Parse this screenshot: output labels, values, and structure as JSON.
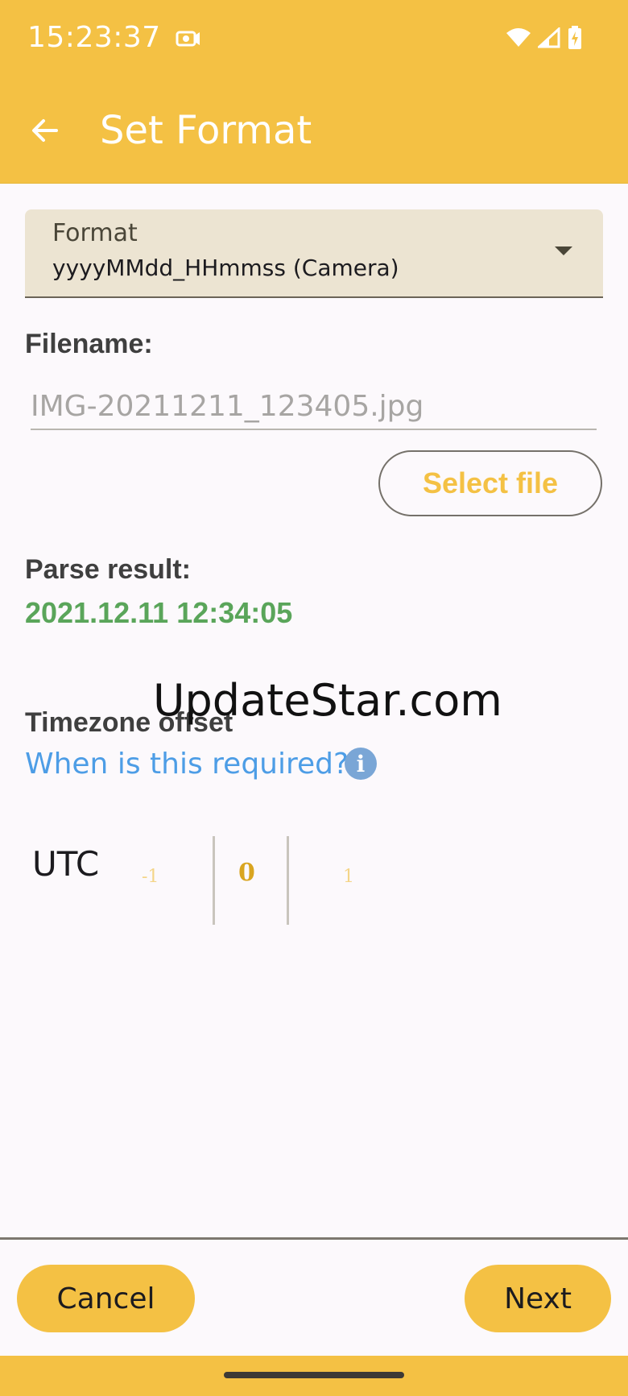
{
  "status_bar": {
    "time": "15:23:37",
    "notification_icon": "photo-notification-icon",
    "wifi_icon": "wifi-icon",
    "signal_icon": "cell-signal-icon",
    "battery_icon": "battery-charging-icon"
  },
  "app_bar": {
    "back_icon": "arrow-back-icon",
    "title": "Set Format"
  },
  "format": {
    "label": "Format",
    "value": "yyyyMMdd_HHmmss (Camera)",
    "dropdown_icon": "caret-down-icon"
  },
  "filename": {
    "label": "Filename:",
    "placeholder": "IMG-20211211_123405.jpg",
    "value": ""
  },
  "select_file": {
    "label": "Select file"
  },
  "parse_result": {
    "label": "Parse result:",
    "value": "2021.12.11 12:34:05"
  },
  "watermark": {
    "text": "UpdateStar.com"
  },
  "timezone": {
    "label": "Timezone offset",
    "help_link": "When is this required?",
    "info_icon": "info-icon",
    "utc_label": "UTC",
    "picker": {
      "prev": "-1",
      "current": "0",
      "next": "1"
    }
  },
  "actions": {
    "cancel": "Cancel",
    "next": "Next"
  },
  "colors": {
    "accent": "#f4c144",
    "success": "#5aa55a",
    "link": "#4d9de6"
  }
}
